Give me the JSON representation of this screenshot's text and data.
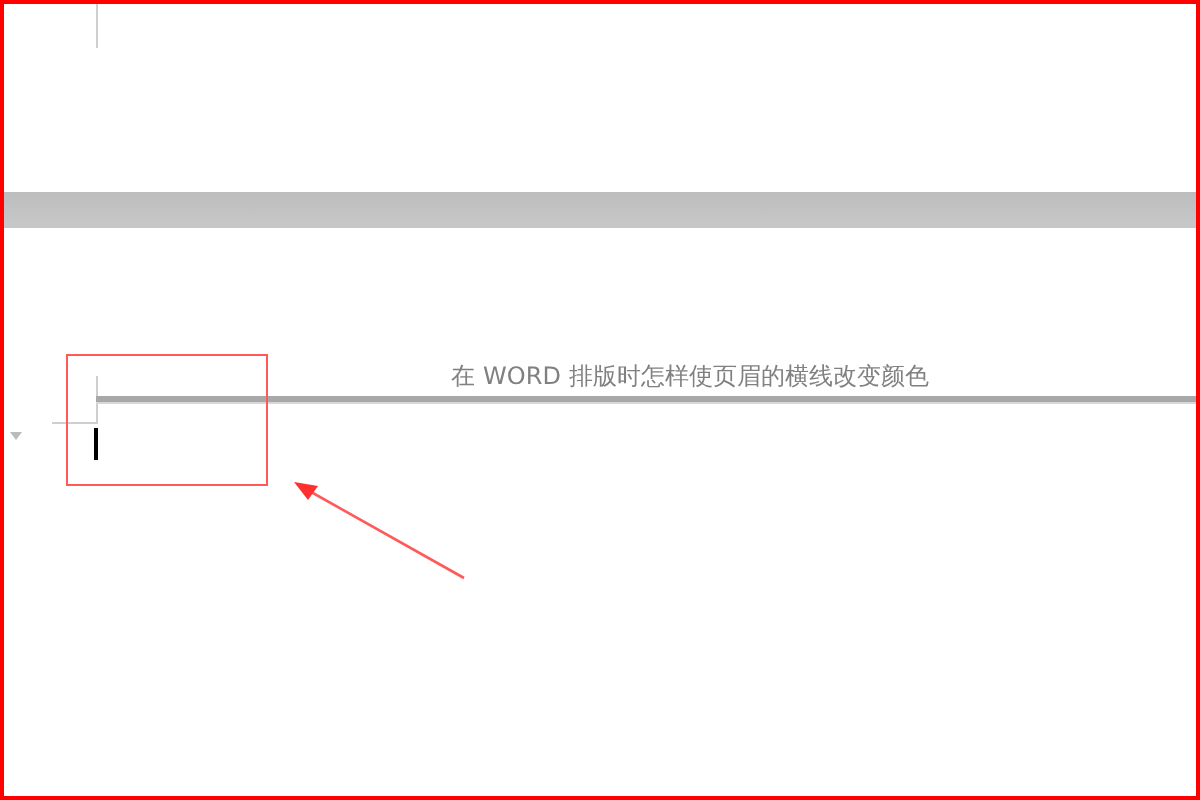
{
  "document": {
    "header_text": "在 WORD 排版时怎样使页眉的横线改变颜色",
    "text_cursor": true
  }
}
